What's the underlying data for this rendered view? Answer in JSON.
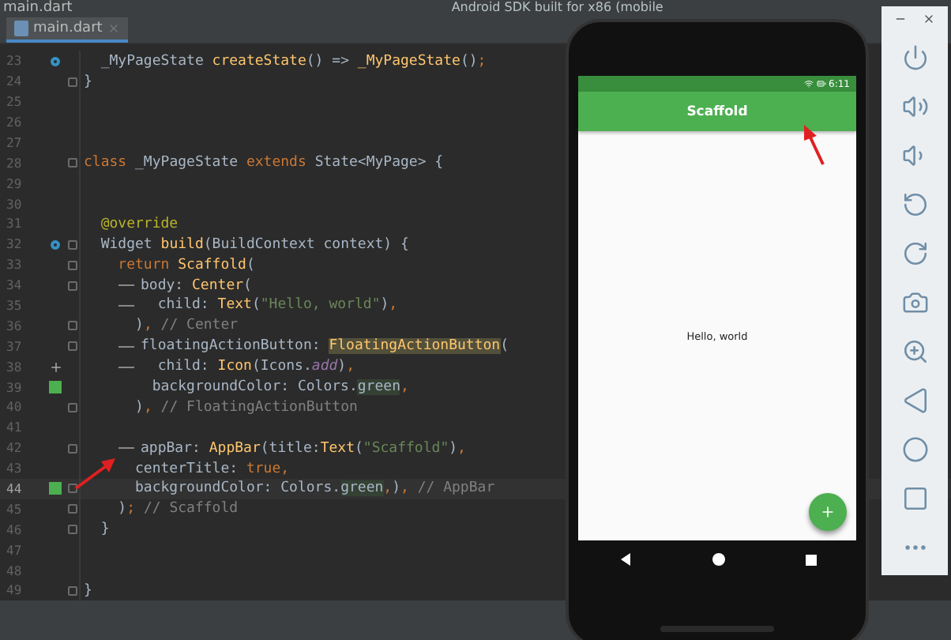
{
  "window": {
    "title": "main.dart"
  },
  "toolbar": {
    "device": "Android SDK built for x86 (mobile"
  },
  "tabs": [
    {
      "label": "main.dart",
      "selected": true
    }
  ],
  "editor": {
    "lines": [
      {
        "number": "23",
        "current": false,
        "gutter": {
          "kind": "override"
        },
        "fold": false,
        "tokens": [
          {
            "kind": "plain",
            "text": "  _MyPageState "
          },
          {
            "kind": "fn",
            "text": "createState"
          },
          {
            "kind": "plain",
            "text": "() => "
          },
          {
            "kind": "fn",
            "text": "_MyPageState"
          },
          {
            "kind": "plain",
            "text": "()"
          },
          {
            "kind": "kw",
            "text": ";"
          }
        ]
      },
      {
        "number": "24",
        "current": false,
        "fold": true,
        "tokens": [
          {
            "kind": "plain",
            "text": "}"
          }
        ]
      },
      {
        "number": "25",
        "current": false,
        "fold": false
      },
      {
        "number": "26",
        "current": false,
        "fold": false
      },
      {
        "number": "27",
        "current": false,
        "fold": false
      },
      {
        "number": "28",
        "current": false,
        "fold": true,
        "tokens": [
          {
            "kind": "kw",
            "text": "class "
          },
          {
            "kind": "plain",
            "text": "_MyPageState "
          },
          {
            "kind": "kw",
            "text": "extends "
          },
          {
            "kind": "plain",
            "text": "State<MyPage> {"
          }
        ]
      },
      {
        "number": "29",
        "current": false,
        "fold": false
      },
      {
        "number": "30",
        "current": false,
        "fold": false
      },
      {
        "number": "31",
        "current": false,
        "fold": false,
        "tokens": [
          {
            "kind": "anno",
            "text": "  @override"
          }
        ]
      },
      {
        "number": "32",
        "current": false,
        "gutter": {
          "kind": "override"
        },
        "fold": true,
        "tokens": [
          {
            "kind": "plain",
            "text": "  Widget "
          },
          {
            "kind": "fn",
            "text": "build"
          },
          {
            "kind": "plain",
            "text": "(BuildContext context) {"
          }
        ]
      },
      {
        "number": "33",
        "current": false,
        "fold": true,
        "tokens": [
          {
            "kind": "kw",
            "text": "    return "
          },
          {
            "kind": "fn",
            "text": "Scaffold"
          },
          {
            "kind": "plain",
            "text": "("
          }
        ]
      },
      {
        "number": "34",
        "current": false,
        "fold": true,
        "guide": true,
        "tokens": [
          {
            "kind": "plain",
            "text": "body: "
          },
          {
            "kind": "fn",
            "text": "Center"
          },
          {
            "kind": "plain",
            "text": "("
          }
        ]
      },
      {
        "number": "35",
        "current": false,
        "fold": false,
        "guide": true,
        "tokens": [
          {
            "kind": "plain",
            "text": "  child: "
          },
          {
            "kind": "fn",
            "text": "Text"
          },
          {
            "kind": "plain",
            "text": "("
          },
          {
            "kind": "str",
            "text": "\"Hello, world\""
          },
          {
            "kind": "plain",
            "text": ")"
          },
          {
            "kind": "kw",
            "text": ","
          }
        ]
      },
      {
        "number": "36",
        "current": false,
        "fold": true,
        "tokens": [
          {
            "kind": "plain",
            "text": "      )"
          },
          {
            "kind": "kw",
            "text": ", "
          },
          {
            "kind": "comment",
            "text": "// Center"
          }
        ]
      },
      {
        "number": "37",
        "current": false,
        "fold": true,
        "guide": true,
        "tokens": [
          {
            "kind": "plain",
            "text": "floatingActionButton: "
          },
          {
            "kind": "mark",
            "text": "FloatingActionButton"
          },
          {
            "kind": "plain",
            "text": "("
          }
        ]
      },
      {
        "number": "38",
        "current": false,
        "gutter": {
          "kind": "add"
        },
        "fold": false,
        "guide": true,
        "tokens": [
          {
            "kind": "plain",
            "text": "  child: "
          },
          {
            "kind": "fn",
            "text": "Icon"
          },
          {
            "kind": "plain",
            "text": "(Icons."
          },
          {
            "kind": "italic",
            "text": "add"
          },
          {
            "kind": "plain",
            "text": ")"
          },
          {
            "kind": "kw",
            "text": ","
          }
        ]
      },
      {
        "number": "39",
        "current": false,
        "gutter": {
          "kind": "color"
        },
        "fold": false,
        "tokens": [
          {
            "kind": "plain",
            "text": "        backgroundColor: Colors."
          },
          {
            "kind": "color",
            "text": "green"
          },
          {
            "kind": "kw",
            "text": ","
          }
        ]
      },
      {
        "number": "40",
        "current": false,
        "fold": true,
        "tokens": [
          {
            "kind": "plain",
            "text": "      )"
          },
          {
            "kind": "kw",
            "text": ", "
          },
          {
            "kind": "comment",
            "text": "// FloatingActionButton"
          }
        ]
      },
      {
        "number": "41",
        "current": false,
        "fold": false
      },
      {
        "number": "42",
        "current": false,
        "fold": true,
        "guide": true,
        "tokens": [
          {
            "kind": "plain",
            "text": "appBar: "
          },
          {
            "kind": "fn",
            "text": "AppBar"
          },
          {
            "kind": "plain",
            "text": "(title:"
          },
          {
            "kind": "fn",
            "text": "Text"
          },
          {
            "kind": "plain",
            "text": "("
          },
          {
            "kind": "str",
            "text": "\"Scaffold\""
          },
          {
            "kind": "plain",
            "text": ")"
          },
          {
            "kind": "kw",
            "text": ","
          }
        ]
      },
      {
        "number": "43",
        "current": false,
        "fold": false,
        "tokens": [
          {
            "kind": "plain",
            "text": "      centerTitle: "
          },
          {
            "kind": "kw",
            "text": "true,"
          }
        ]
      },
      {
        "number": "44",
        "current": true,
        "gutter": {
          "kind": "color"
        },
        "fold": true,
        "tokens": [
          {
            "kind": "plain",
            "text": "      backgroundColor: Colors."
          },
          {
            "kind": "color",
            "text": "green"
          },
          {
            "kind": "kw",
            "text": ","
          },
          {
            "kind": "plain",
            "text": ")"
          },
          {
            "kind": "kw",
            "text": ", "
          },
          {
            "kind": "comment",
            "text": "// AppBar"
          }
        ]
      },
      {
        "number": "45",
        "current": false,
        "fold": true,
        "tokens": [
          {
            "kind": "plain",
            "text": "    )"
          },
          {
            "kind": "kw",
            "text": "; "
          },
          {
            "kind": "comment",
            "text": "// Scaffold"
          }
        ]
      },
      {
        "number": "46",
        "current": false,
        "fold": true,
        "tokens": [
          {
            "kind": "plain",
            "text": "  }"
          }
        ]
      },
      {
        "number": "47",
        "current": false,
        "fold": false
      },
      {
        "number": "48",
        "current": false,
        "fold": false
      },
      {
        "number": "49",
        "current": false,
        "fold": true,
        "tokens": [
          {
            "kind": "plain",
            "text": "}"
          }
        ]
      }
    ]
  },
  "emulator": {
    "status_time": "6:11",
    "app_bar_title": "Scaffold",
    "body_text": "Hello, world"
  }
}
